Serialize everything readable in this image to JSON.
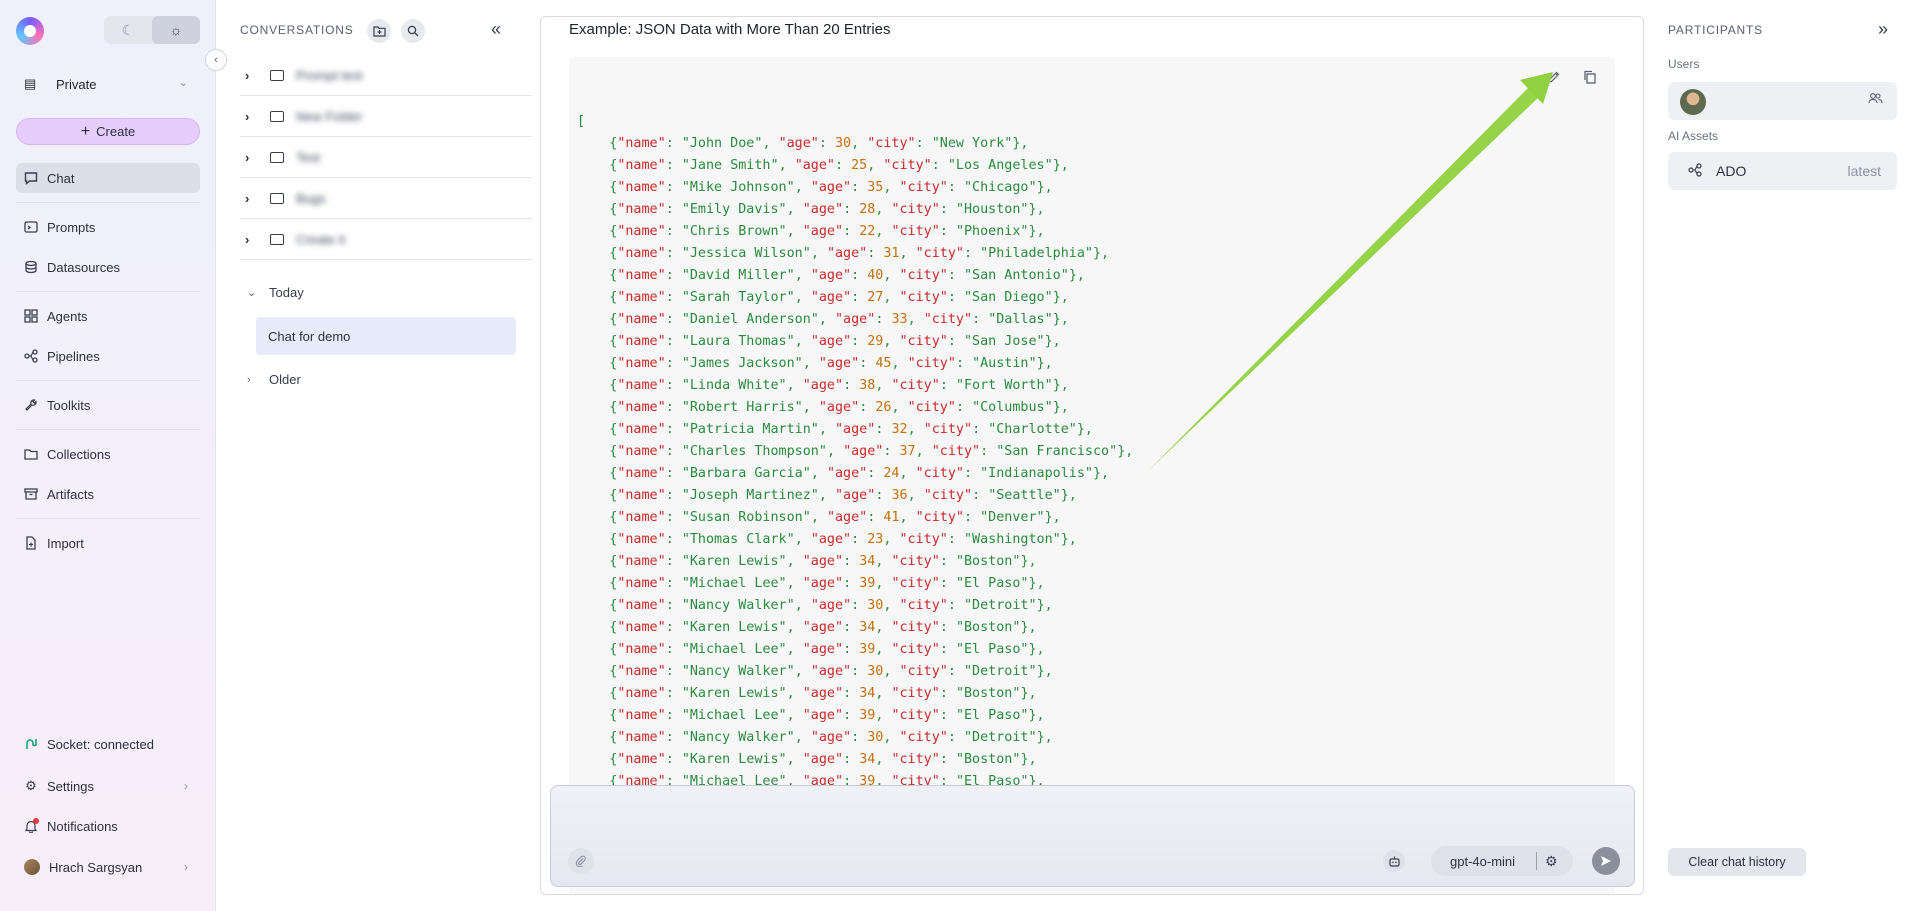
{
  "nav": {
    "workspace": "Private",
    "create_label": "Create",
    "items": [
      {
        "label": "Chat",
        "icon": "chat-icon"
      },
      {
        "label": "Prompts",
        "icon": "prompt-icon"
      },
      {
        "label": "Datasources",
        "icon": "database-icon"
      },
      {
        "label": "Agents",
        "icon": "grid-icon"
      },
      {
        "label": "Pipelines",
        "icon": "pipeline-icon"
      },
      {
        "label": "Toolkits",
        "icon": "wrench-icon"
      },
      {
        "label": "Collections",
        "icon": "folder-icon"
      },
      {
        "label": "Artifacts",
        "icon": "archive-icon"
      },
      {
        "label": "Import",
        "icon": "file-import-icon"
      }
    ],
    "socket_status": "Socket: connected",
    "settings_label": "Settings",
    "notifications_label": "Notifications",
    "user_name": "Hrach Sargsyan"
  },
  "conversations": {
    "header": "CONVERSATIONS",
    "folders": [
      "Prompt test",
      "New Folder",
      "Test",
      "Bugs",
      "Create it"
    ],
    "today_label": "Today",
    "today_items": [
      "Chat for demo"
    ],
    "older_label": "Older"
  },
  "chat": {
    "message_title": "Example: JSON Data with More Than 20 Entries",
    "code_open": "[",
    "entries": [
      {
        "name": "John Doe",
        "age": 30,
        "city": "New York"
      },
      {
        "name": "Jane Smith",
        "age": 25,
        "city": "Los Angeles"
      },
      {
        "name": "Mike Johnson",
        "age": 35,
        "city": "Chicago"
      },
      {
        "name": "Emily Davis",
        "age": 28,
        "city": "Houston"
      },
      {
        "name": "Chris Brown",
        "age": 22,
        "city": "Phoenix"
      },
      {
        "name": "Jessica Wilson",
        "age": 31,
        "city": "Philadelphia"
      },
      {
        "name": "David Miller",
        "age": 40,
        "city": "San Antonio"
      },
      {
        "name": "Sarah Taylor",
        "age": 27,
        "city": "San Diego"
      },
      {
        "name": "Daniel Anderson",
        "age": 33,
        "city": "Dallas"
      },
      {
        "name": "Laura Thomas",
        "age": 29,
        "city": "San Jose"
      },
      {
        "name": "James Jackson",
        "age": 45,
        "city": "Austin"
      },
      {
        "name": "Linda White",
        "age": 38,
        "city": "Fort Worth"
      },
      {
        "name": "Robert Harris",
        "age": 26,
        "city": "Columbus"
      },
      {
        "name": "Patricia Martin",
        "age": 32,
        "city": "Charlotte"
      },
      {
        "name": "Charles Thompson",
        "age": 37,
        "city": "San Francisco"
      },
      {
        "name": "Barbara Garcia",
        "age": 24,
        "city": "Indianapolis"
      },
      {
        "name": "Joseph Martinez",
        "age": 36,
        "city": "Seattle"
      },
      {
        "name": "Susan Robinson",
        "age": 41,
        "city": "Denver"
      },
      {
        "name": "Thomas Clark",
        "age": 23,
        "city": "Washington"
      },
      {
        "name": "Karen Lewis",
        "age": 34,
        "city": "Boston"
      },
      {
        "name": "Michael Lee",
        "age": 39,
        "city": "El Paso"
      },
      {
        "name": "Nancy Walker",
        "age": 30,
        "city": "Detroit"
      },
      {
        "name": "Karen Lewis",
        "age": 34,
        "city": "Boston"
      },
      {
        "name": "Michael Lee",
        "age": 39,
        "city": "El Paso"
      },
      {
        "name": "Nancy Walker",
        "age": 30,
        "city": "Detroit"
      },
      {
        "name": "Karen Lewis",
        "age": 34,
        "city": "Boston"
      },
      {
        "name": "Michael Lee",
        "age": 39,
        "city": "El Paso"
      },
      {
        "name": "Nancy Walker",
        "age": 30,
        "city": "Detroit"
      },
      {
        "name": "Karen Lewis",
        "age": 34,
        "city": "Boston"
      },
      {
        "name": "Michael Lee",
        "age": 39,
        "city": "El Paso"
      }
    ],
    "model": "gpt-4o-mini"
  },
  "participants": {
    "title": "PARTICIPANTS",
    "users_label": "Users",
    "assets_label": "AI Assets",
    "asset_name": "ADO",
    "asset_version": "latest",
    "clear_label": "Clear chat history"
  },
  "colors": {
    "accent": "#e6cdfb",
    "annotation_arrow": "#8fd13f",
    "json_key": "#c92a2a",
    "json_string": "#2b8a3e",
    "json_number": "#c2700a"
  }
}
